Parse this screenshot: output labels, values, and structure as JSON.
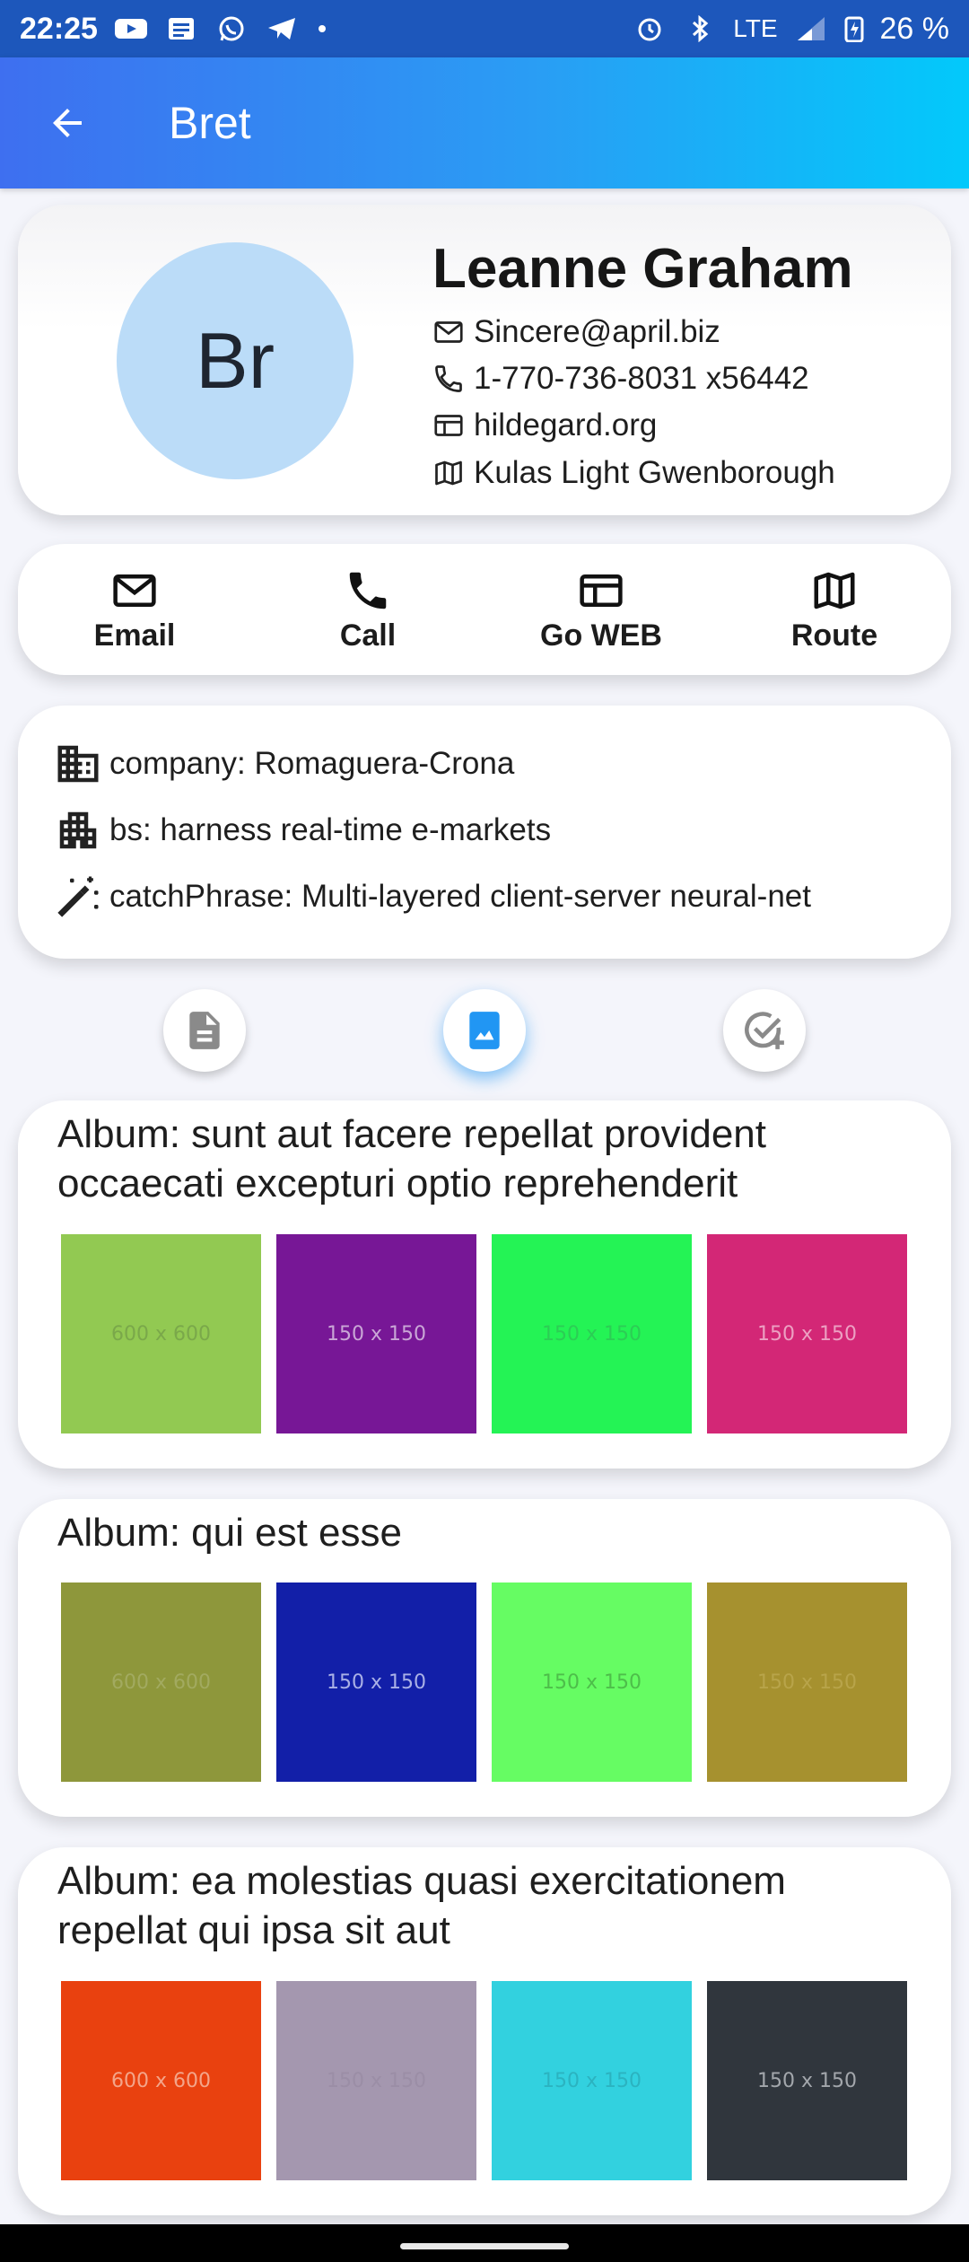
{
  "status_bar": {
    "time": "22:25",
    "network": "LTE",
    "battery": "26 %",
    "notification_icons": [
      "youtube-icon",
      "news-icon",
      "whatsapp-icon",
      "telegram-icon",
      "dot-icon"
    ],
    "system_icons": [
      "alarm-icon",
      "bluetooth-icon",
      "signal-icon",
      "battery-charging-icon"
    ]
  },
  "app_bar": {
    "title": "Bret",
    "back_icon": "arrow-back-icon"
  },
  "profile": {
    "initials": "Br",
    "name": "Leanne Graham",
    "email": "Sincere@april.biz",
    "phone": "1-770-736-8031 x56442",
    "website": "hildegard.org",
    "address": "Kulas Light Gwenborough",
    "avatar_color": "#bbdcf8"
  },
  "actions": [
    {
      "label": "Email",
      "icon": "mail-icon"
    },
    {
      "label": "Call",
      "icon": "phone-icon"
    },
    {
      "label": "Go WEB",
      "icon": "web-icon"
    },
    {
      "label": "Route",
      "icon": "map-icon"
    }
  ],
  "company": {
    "name_line": "company: Romaguera-Crona",
    "bs_line": "bs: harness real-time e-markets",
    "catchphrase_line": "catchPhrase: Multi-layered client-server neural-net"
  },
  "tabs": [
    {
      "name": "posts",
      "icon": "article-icon",
      "active": false
    },
    {
      "name": "albums",
      "icon": "photo-album-icon",
      "active": true
    },
    {
      "name": "todos",
      "icon": "task-add-icon",
      "active": false
    }
  ],
  "albums": [
    {
      "title": "Album: sunt aut facere repellat provident occaecati excepturi optio reprehenderit",
      "photos": [
        {
          "label": "600 x 600",
          "color": "#92c952",
          "text_color": "#7aa84a"
        },
        {
          "label": "150 x 150",
          "color": "#771796",
          "text_color": "#c9a6d6"
        },
        {
          "label": "150 x 150",
          "color": "#24f355",
          "text_color": "#2ccd55"
        },
        {
          "label": "150 x 150",
          "color": "#d32776",
          "text_color": "#eca0c2"
        }
      ]
    },
    {
      "title": "Album: qui est esse",
      "photos": [
        {
          "label": "600 x 600",
          "color": "#8e973b",
          "text_color": "#a2aa60"
        },
        {
          "label": "150 x 150",
          "color": "#121fa8",
          "text_color": "#a9b0e6"
        },
        {
          "label": "150 x 150",
          "color": "#66fc63",
          "text_color": "#4dbe4a"
        },
        {
          "label": "150 x 150",
          "color": "#a6912f",
          "text_color": "#b8a44a"
        }
      ]
    },
    {
      "title": "Album: ea molestias quasi exercitationem repellat qui ipsa sit aut",
      "photos": [
        {
          "label": "600 x 600",
          "color": "#e9410f",
          "text_color": "#f3a58a"
        },
        {
          "label": "150 x 150",
          "color": "#a497af",
          "text_color": "#9b8ea6"
        },
        {
          "label": "150 x 150",
          "color": "#32d1df",
          "text_color": "#2bb3c0"
        },
        {
          "label": "150 x 150",
          "color": "#30363d",
          "text_color": "#a3a7ac"
        }
      ]
    }
  ]
}
